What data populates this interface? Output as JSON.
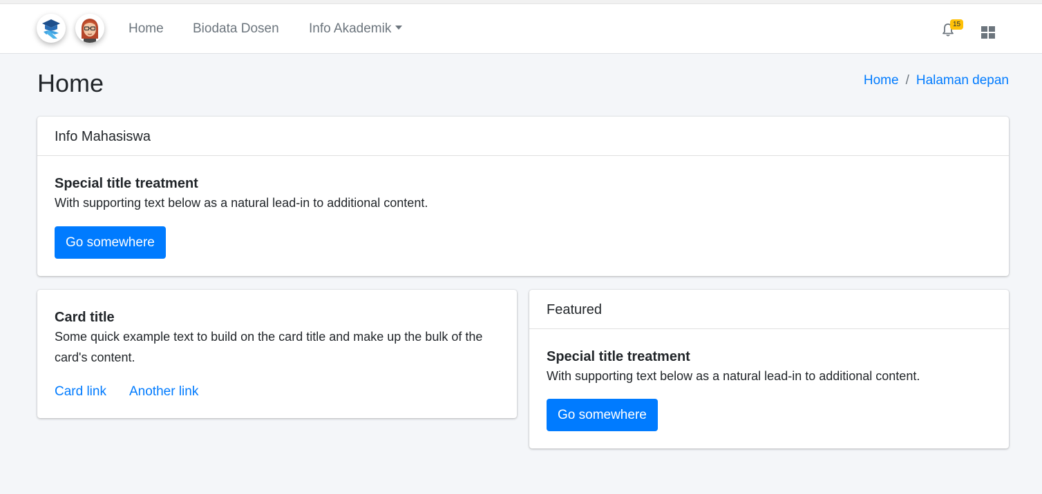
{
  "navbar": {
    "logo_icon": "graduation-cap-logo-icon",
    "avatar_icon": "user-avatar-icon",
    "links": [
      {
        "label": "Home"
      },
      {
        "label": "Biodata Dosen"
      },
      {
        "label": "Info Akademik"
      }
    ],
    "notifications": {
      "icon": "bell-icon",
      "count": "15"
    },
    "apps_icon": "grid-icon"
  },
  "page": {
    "title": "Home",
    "breadcrumb": [
      "Home",
      "Halaman depan"
    ]
  },
  "cards": {
    "info": {
      "header": "Info Mahasiswa",
      "title": "Special title treatment",
      "text": "With supporting text below as a natural lead-in to additional content.",
      "button": "Go somewhere"
    },
    "basic": {
      "title": "Card title",
      "text": "Some quick example text to build on the card title and make up the bulk of the card's content.",
      "links": [
        "Card link",
        "Another link"
      ]
    },
    "featured": {
      "header": "Featured",
      "title": "Special title treatment",
      "text": "With supporting text below as a natural lead-in to additional content.",
      "button": "Go somewhere"
    }
  },
  "colors": {
    "primary": "#007bff",
    "badge": "#ffc107",
    "background": "#f4f6f9"
  }
}
